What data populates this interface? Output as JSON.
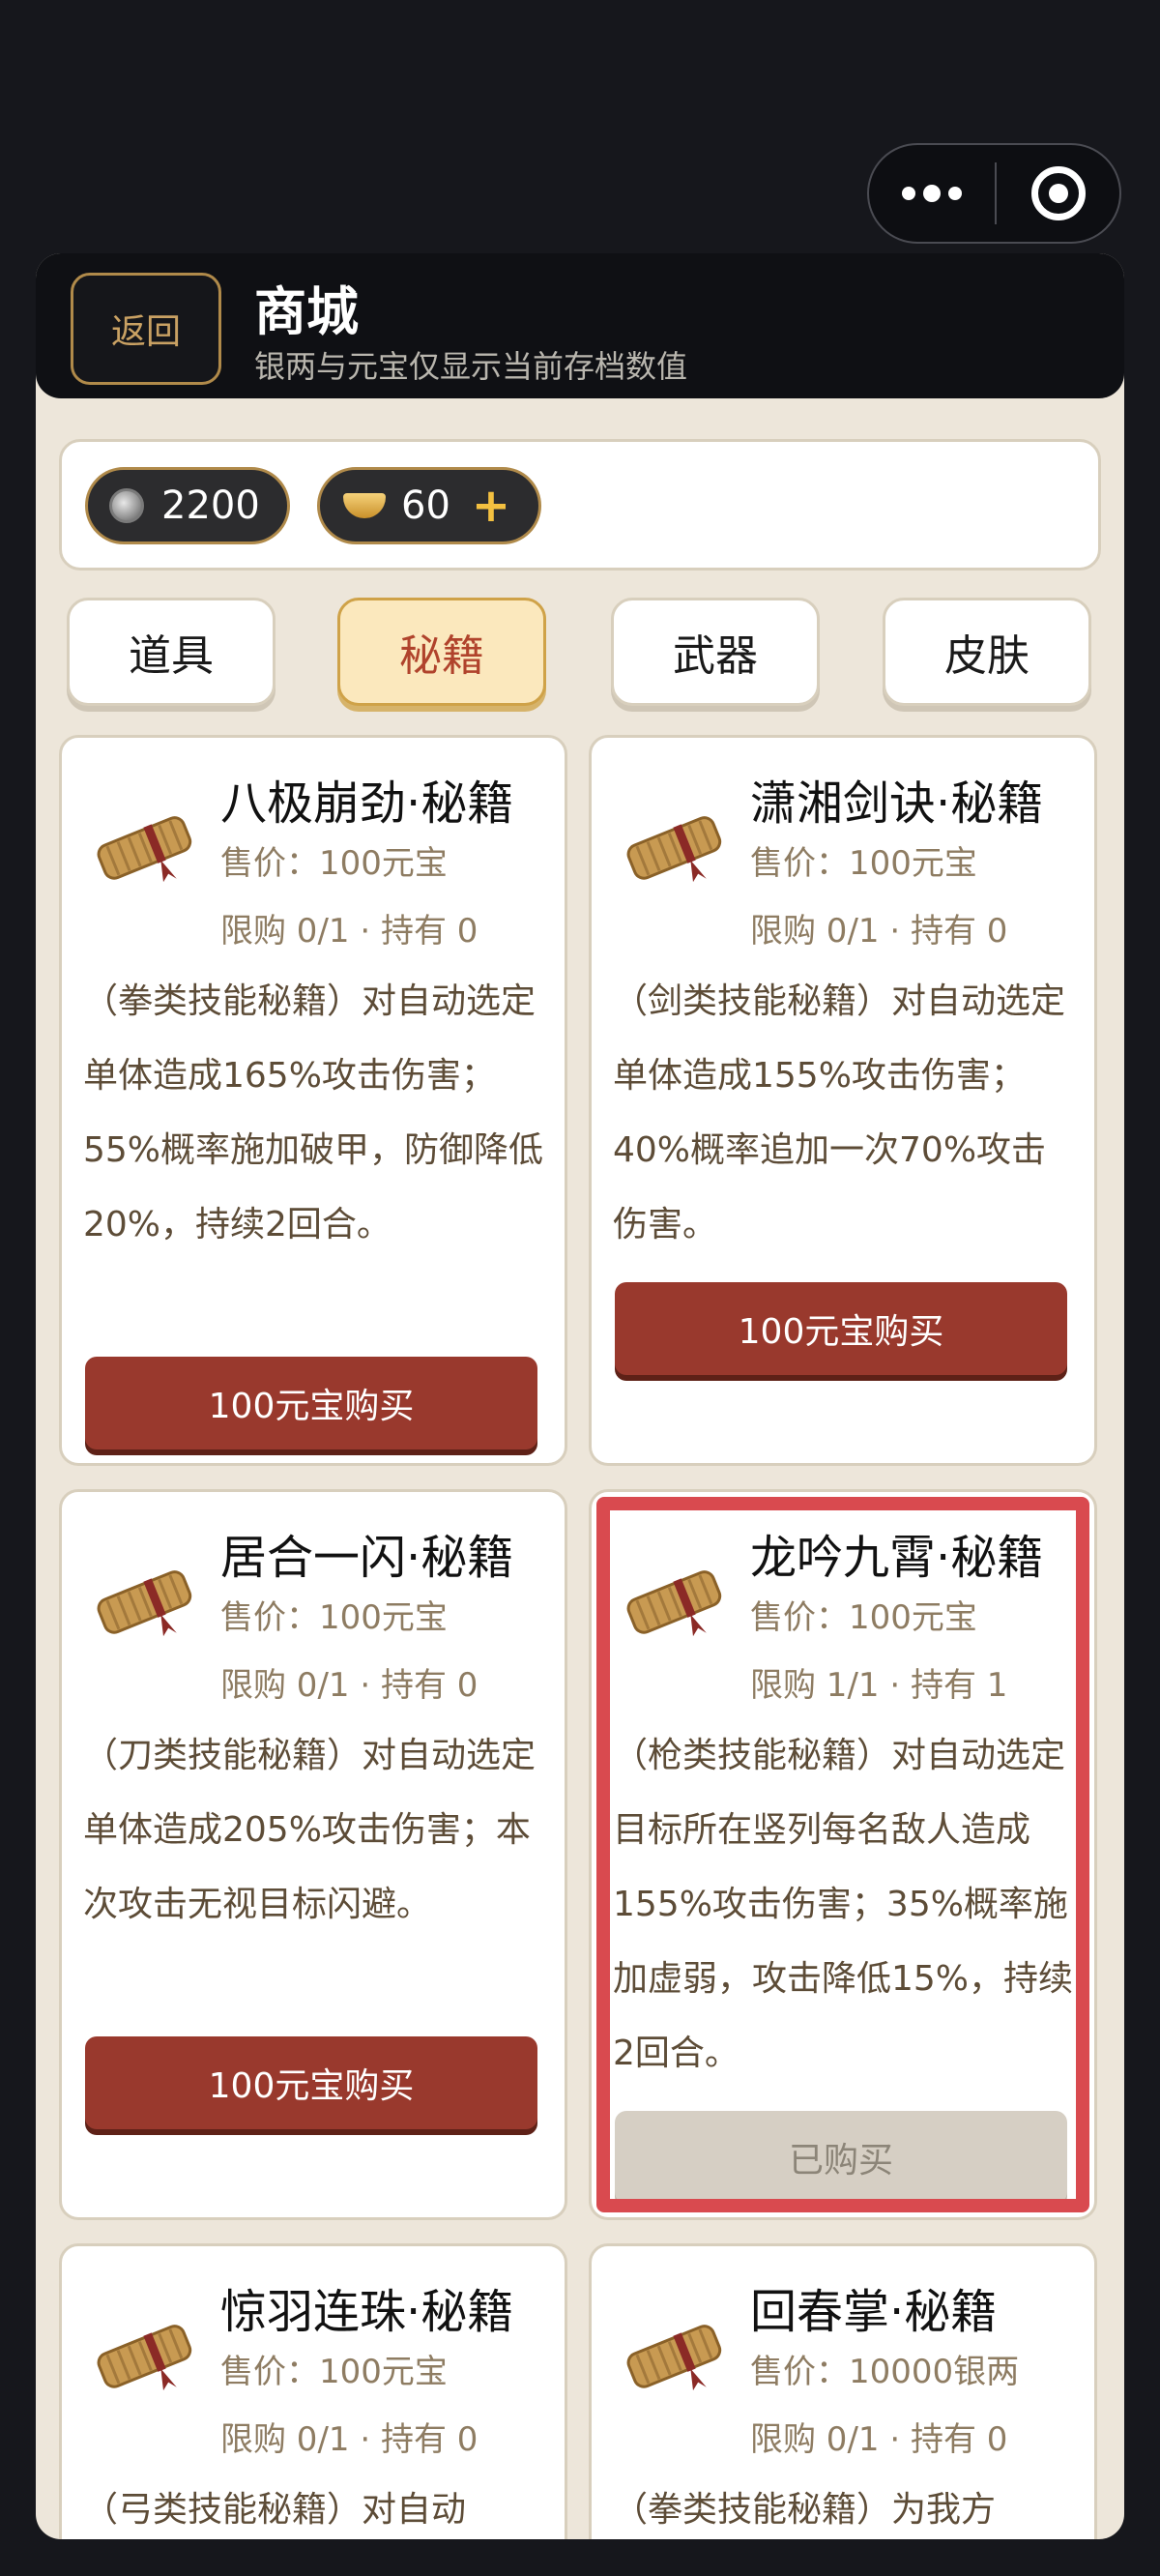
{
  "header": {
    "back_label": "返回",
    "title": "商城",
    "subtitle": "银两与元宝仅显示当前存档数值"
  },
  "currency": {
    "silver": "2200",
    "gold": "60"
  },
  "tabs": [
    {
      "label": "道具",
      "active": false
    },
    {
      "label": "秘籍",
      "active": true
    },
    {
      "label": "武器",
      "active": false
    },
    {
      "label": "皮肤",
      "active": false
    }
  ],
  "items": [
    {
      "name": "八极崩劲·秘籍",
      "price": "售价：100元宝",
      "limit": "限购 0/1 · 持有 0",
      "desc": "（拳类技能秘籍）对自动选定单体造成165%攻击伤害；55%概率施加破甲，防御降低20%，持续2回合。",
      "button": "100元宝购买"
    },
    {
      "name": "潇湘剑诀·秘籍",
      "price": "售价：100元宝",
      "limit": "限购 0/1 · 持有 0",
      "desc": "（剑类技能秘籍）对自动选定单体造成155%攻击伤害；40%概率追加一次70%攻击伤害。",
      "button": "100元宝购买"
    },
    {
      "name": "居合一闪·秘籍",
      "price": "售价：100元宝",
      "limit": "限购 0/1 · 持有 0",
      "desc": "（刀类技能秘籍）对自动选定单体造成205%攻击伤害；本次攻击无视目标闪避。",
      "button": "100元宝购买"
    },
    {
      "name": "龙吟九霄·秘籍",
      "price": "售价：100元宝",
      "limit": "限购 1/1 · 持有 1",
      "desc": "（枪类技能秘籍）对自动选定目标所在竖列每名敌人造成155%攻击伤害；35%概率施加虚弱，攻击降低15%，持续2回合。",
      "button": "已购买"
    },
    {
      "name": "惊羽连珠·秘籍",
      "price": "售价：100元宝",
      "limit": "限购 0/1 · 持有 0",
      "desc": "（弓类技能秘籍）对自动"
    },
    {
      "name": "回春掌·秘籍",
      "price": "售价：10000银两",
      "limit": "限购 0/1 · 持有 0",
      "desc": "（拳类技能秘籍）为我方"
    }
  ]
}
